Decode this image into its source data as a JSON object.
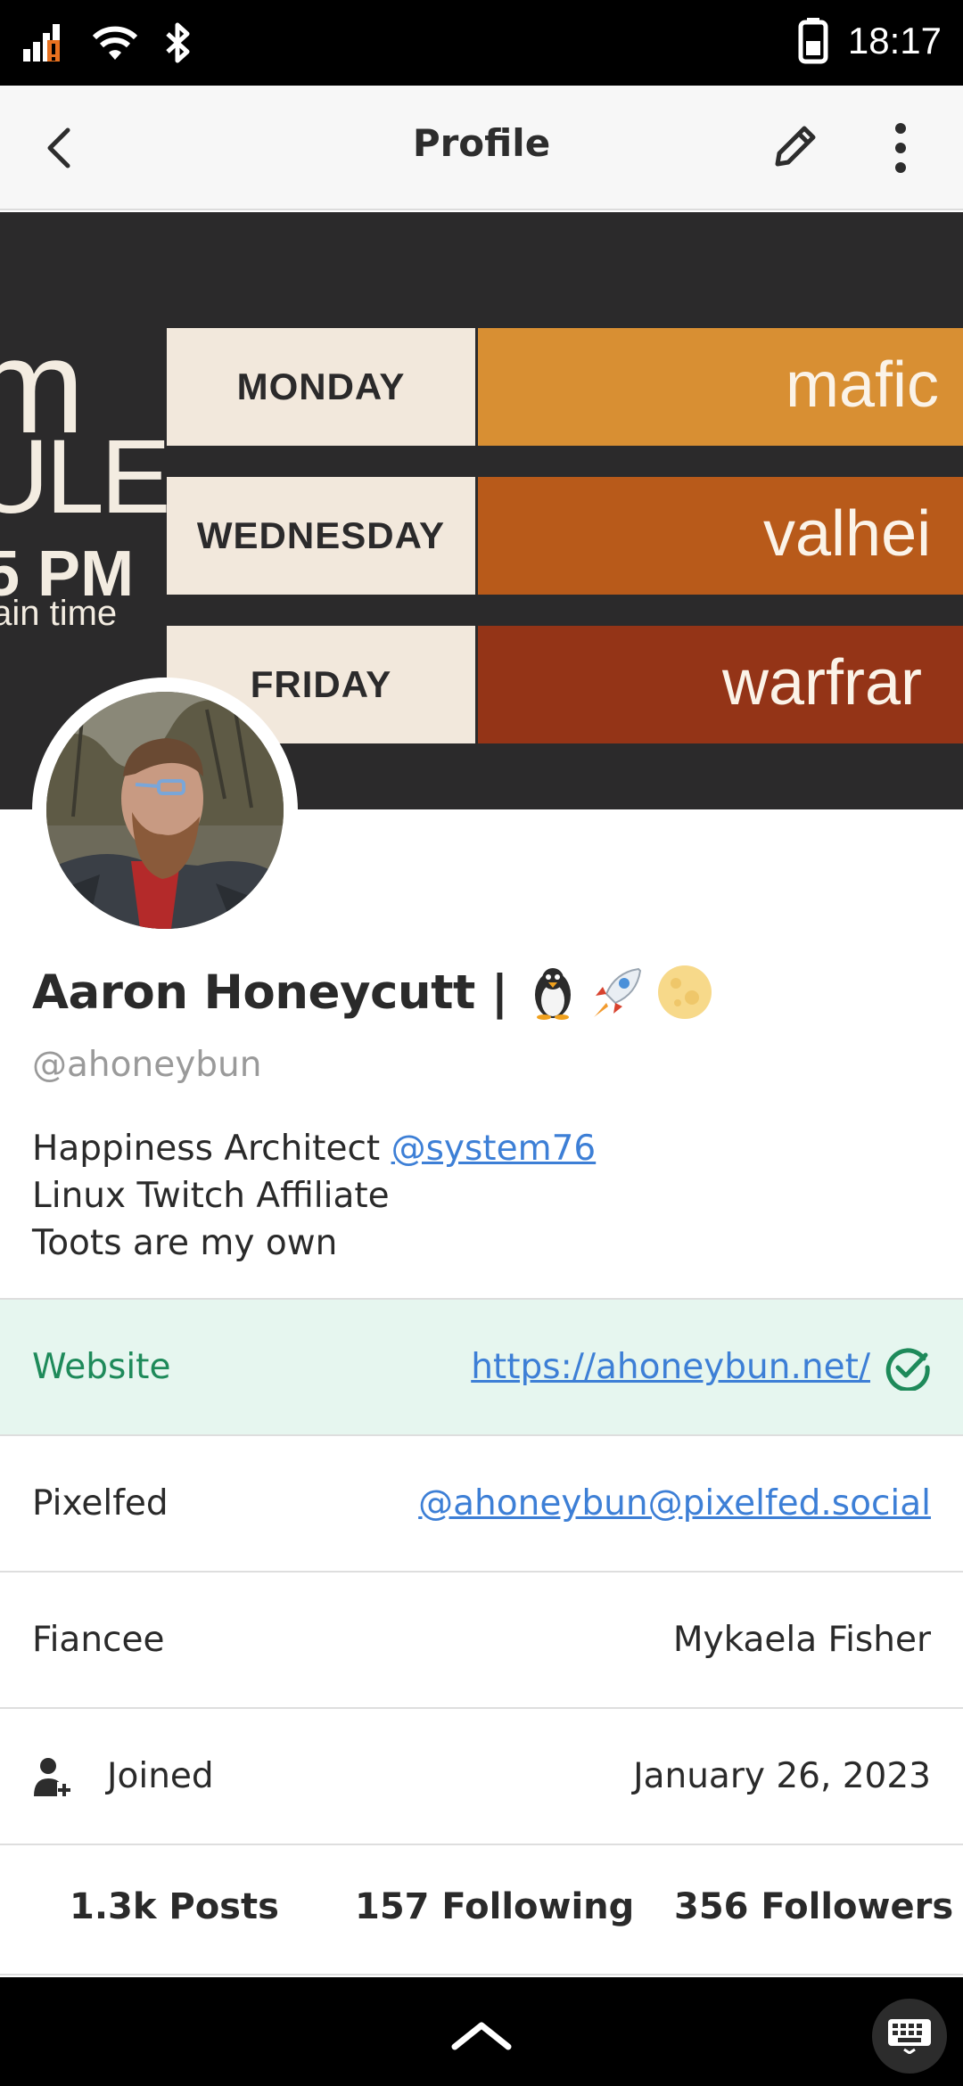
{
  "status_bar": {
    "time": "18:17",
    "icons": [
      "signal-icon",
      "wifi-icon",
      "bluetooth-icon",
      "battery-icon"
    ]
  },
  "app_bar": {
    "title": "Profile",
    "back_icon": "arrow-back-icon",
    "edit_icon": "pencil-icon",
    "more_icon": "more-vert-icon"
  },
  "banner": {
    "left_big_1": "m",
    "left_big_2": "ULE",
    "left_time": "5 PM",
    "left_tz": "tain time",
    "schedule": [
      {
        "day": "MONDAY",
        "game": "mafic",
        "color": "#d88f33"
      },
      {
        "day": "WEDNESDAY",
        "game": "valhei",
        "color": "#b85a1a"
      },
      {
        "day": "FRIDAY",
        "game": "warfrar",
        "color": "#943417"
      }
    ]
  },
  "profile": {
    "display_name": "Aaron Honeycutt |",
    "emojis": [
      "penguin",
      "rocket",
      "full-moon"
    ],
    "handle": "@ahoneybun",
    "bio": {
      "line1_text": "Happiness Architect ",
      "line1_link": "@system76",
      "line2": "Linux Twitch Affiliate",
      "line3": "Toots are my own"
    }
  },
  "fields": [
    {
      "label": "Website",
      "value": "https://ahoneybun.net/",
      "link": true,
      "verified": true
    },
    {
      "label": "Pixelfed",
      "value": "@ahoneybun@pixelfed.social",
      "link": true,
      "verified": false
    },
    {
      "label": "Fiancee",
      "value": "Mykaela Fisher",
      "link": false,
      "verified": false
    }
  ],
  "joined": {
    "label": "Joined",
    "date": "January 26, 2023"
  },
  "counts": {
    "posts": "1.3k Posts",
    "following": "157 Following",
    "followers": "356 Followers"
  },
  "colors": {
    "link": "#3d7fd6",
    "verified": "#1e8a5a",
    "verified_bg": "#e6f6ef"
  }
}
